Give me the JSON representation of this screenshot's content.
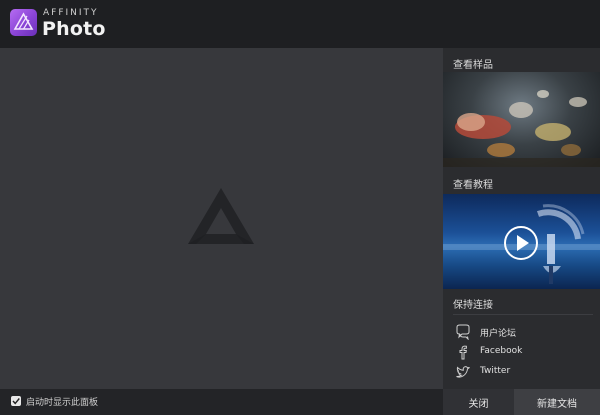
{
  "header": {
    "brand_small": "AFFINITY",
    "brand_big": "Photo"
  },
  "sidebar": {
    "samples_title": "查看样品",
    "tutorials_title": "查看教程",
    "connect_title": "保持连接",
    "links": [
      {
        "label": "用户论坛",
        "icon": "speech-bubble-icon"
      },
      {
        "label": "Facebook",
        "icon": "facebook-icon"
      },
      {
        "label": "Twitter",
        "icon": "twitter-icon"
      }
    ]
  },
  "footer": {
    "show_on_startup_label": "启动时显示此面板",
    "show_on_startup_checked": true,
    "close_label": "关闭",
    "new_document_label": "新建文档"
  },
  "colors": {
    "accent": "#9b55e6",
    "canvas": "#37383c",
    "panel": "#2b2c2f"
  }
}
